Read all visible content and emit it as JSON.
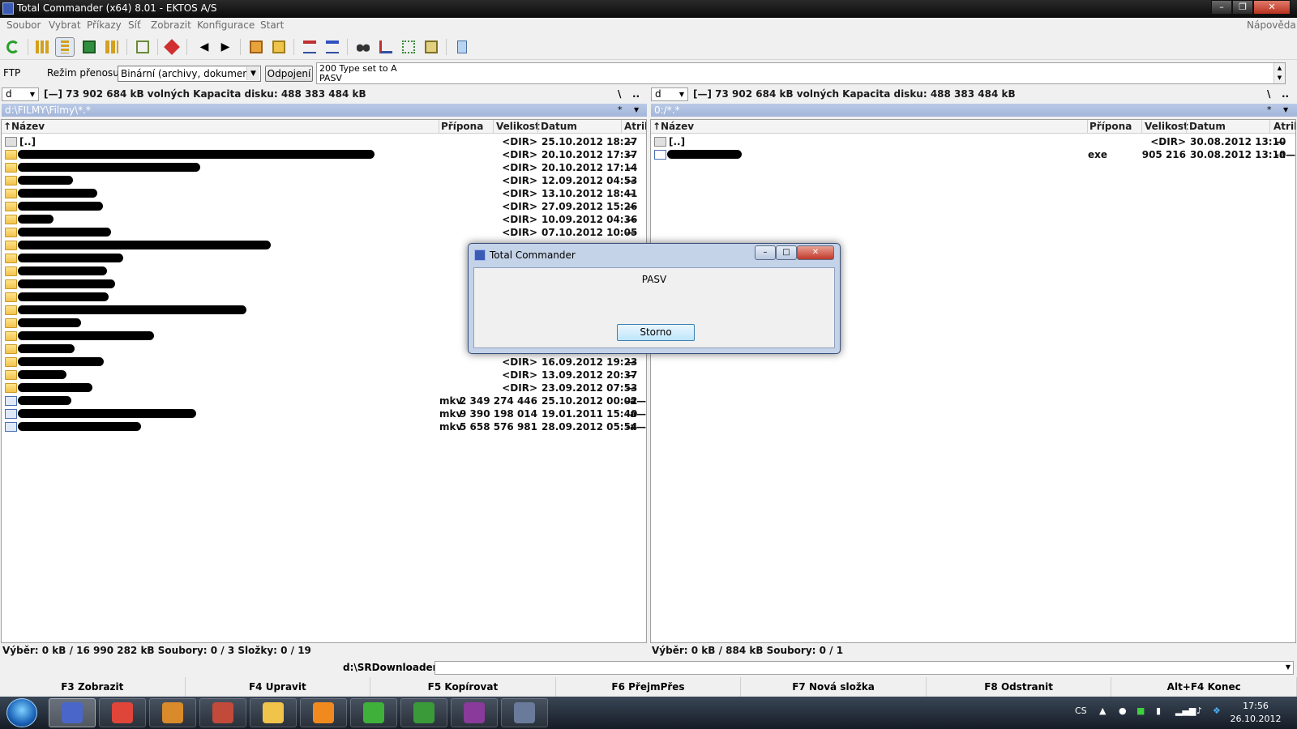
{
  "window": {
    "title": "Total Commander (x64) 8.01 - EKTOS A/S"
  },
  "menu": {
    "items": [
      "Soubor",
      "Vybrat",
      "Příkazy",
      "Síť",
      "Zobrazit",
      "Konfigurace",
      "Start"
    ],
    "help": "Nápověda"
  },
  "ftp": {
    "label": "FTP",
    "mode_label": "Režim přenosu",
    "mode_value": "Binární (archivy, dokument",
    "disconnect": "Odpojení",
    "log": [
      "200 Type set to A",
      "PASV"
    ]
  },
  "left": {
    "drive": "d",
    "drive_info": "[—]  73 902 684 kB volných  Kapacita disku: 488 383 484 kB",
    "nav_root": "\\",
    "nav_up": "..",
    "path": "d:\\FILMY\\Filmy\\*.*",
    "filter": "*",
    "columns": {
      "name": "Název",
      "ext": "Přípona",
      "size": "Velikost",
      "date": "Datum",
      "attr": "Atribu"
    },
    "rows": [
      {
        "name": "[..]",
        "ext": "",
        "size": "<DIR>",
        "date": "25.10.2012 18:27",
        "attr": "—",
        "icon": "updir",
        "redact": 0
      },
      {
        "name": "",
        "ext": "",
        "size": "<DIR>",
        "date": "20.10.2012 17:37",
        "attr": "—",
        "icon": "folder",
        "redact": 440
      },
      {
        "name": "",
        "ext": "",
        "size": "<DIR>",
        "date": "20.10.2012 17:14",
        "attr": "—",
        "icon": "folder",
        "redact": 225
      },
      {
        "name": "",
        "ext": "",
        "size": "<DIR>",
        "date": "12.09.2012 04:53",
        "attr": "—",
        "icon": "folder",
        "redact": 68
      },
      {
        "name": "",
        "ext": "",
        "size": "<DIR>",
        "date": "13.10.2012 18:41",
        "attr": "—",
        "icon": "folder",
        "redact": 98
      },
      {
        "name": "",
        "ext": "",
        "size": "<DIR>",
        "date": "27.09.2012 15:26",
        "attr": "—",
        "icon": "folder",
        "redact": 105
      },
      {
        "name": "",
        "ext": "",
        "size": "<DIR>",
        "date": "10.09.2012 04:36",
        "attr": "—",
        "icon": "folder",
        "redact": 44
      },
      {
        "name": "",
        "ext": "",
        "size": "<DIR>",
        "date": "07.10.2012 10:05",
        "attr": "—",
        "icon": "folder",
        "redact": 115
      },
      {
        "name": "",
        "ext": "",
        "size": "",
        "date": "",
        "attr": "",
        "icon": "folder",
        "redact": 312
      },
      {
        "name": "",
        "ext": "",
        "size": "",
        "date": "",
        "attr": "",
        "icon": "folder",
        "redact": 130
      },
      {
        "name": "",
        "ext": "",
        "size": "",
        "date": "",
        "attr": "",
        "icon": "folder",
        "redact": 110
      },
      {
        "name": "",
        "ext": "",
        "size": "",
        "date": "",
        "attr": "",
        "icon": "folder",
        "redact": 120
      },
      {
        "name": "",
        "ext": "",
        "size": "",
        "date": "",
        "attr": "",
        "icon": "folder",
        "redact": 112
      },
      {
        "name": "",
        "ext": "",
        "size": "",
        "date": "",
        "attr": "",
        "icon": "folder",
        "redact": 282
      },
      {
        "name": "",
        "ext": "",
        "size": "",
        "date": "",
        "attr": "",
        "icon": "folder",
        "redact": 78
      },
      {
        "name": "",
        "ext": "",
        "size": "",
        "date": "",
        "attr": "",
        "icon": "folder",
        "redact": 168
      },
      {
        "name": "",
        "ext": "",
        "size": "",
        "date": "",
        "attr": "",
        "icon": "folder",
        "redact": 70
      },
      {
        "name": "",
        "ext": "",
        "size": "<DIR>",
        "date": "16.09.2012 19:23",
        "attr": "—",
        "icon": "folder",
        "redact": 106
      },
      {
        "name": "",
        "ext": "",
        "size": "<DIR>",
        "date": "13.09.2012 20:37",
        "attr": "—",
        "icon": "folder",
        "redact": 60
      },
      {
        "name": "",
        "ext": "",
        "size": "<DIR>",
        "date": "23.09.2012 07:53",
        "attr": "—",
        "icon": "folder",
        "redact": 92
      },
      {
        "name": "",
        "ext": "mkv",
        "size": "2 349 274 446",
        "date": "25.10.2012 00:02",
        "attr": "-a—",
        "icon": "mkv",
        "redact": 66
      },
      {
        "name": "",
        "ext": "mkv",
        "size": "9 390 198 014",
        "date": "19.01.2011 15:40",
        "attr": "-a—",
        "icon": "mkv",
        "redact": 220
      },
      {
        "name": "",
        "ext": "mkv",
        "size": "5 658 576 981",
        "date": "28.09.2012 05:54",
        "attr": "-a—",
        "icon": "mkv",
        "redact": 152
      }
    ],
    "status": "Výběr: 0 kB / 16 990 282 kB  Soubory: 0 / 3  Složky: 0 / 19"
  },
  "right": {
    "drive": "d",
    "drive_info": "[—]  73 902 684 kB volných  Kapacita disku: 488 383 484 kB",
    "nav_root": "\\",
    "nav_up": "..",
    "path": "0:/*.*",
    "filter": "*",
    "columns": {
      "name": "Název",
      "ext": "Přípona",
      "size": "Velikost",
      "date": "Datum",
      "attr": "Atribu"
    },
    "rows": [
      {
        "name": "[..]",
        "ext": "",
        "size": "<DIR>",
        "date": "30.08.2012 13:10",
        "attr": "—",
        "icon": "updir",
        "redact": 0
      },
      {
        "name": "",
        "ext": "exe",
        "size": "905 216",
        "date": "30.08.2012 13:10",
        "attr": "-a—",
        "icon": "exe",
        "redact": 92
      }
    ],
    "status": "Výběr: 0 kB / 884 kB  Soubory: 0 / 1"
  },
  "cmdline": {
    "prompt": "d:\\SRDownloader>"
  },
  "fkeys": [
    "F3 Zobrazit",
    "F4 Upravit",
    "F5 Kopírovat",
    "F6 PřejmPřes",
    "F7 Nová složka",
    "F8 Odstranit",
    "Alt+F4 Konec"
  ],
  "dialog": {
    "title": "Total Commander",
    "message": "PASV",
    "button": "Storno"
  },
  "tray": {
    "lang": "CS",
    "time": "17:56",
    "date": "26.10.2012"
  },
  "taskbar": {
    "apps": [
      {
        "name": "total-commander-taskbar",
        "color": "#4a66c9"
      },
      {
        "name": "chrome-taskbar",
        "color": "#e0453a"
      },
      {
        "name": "monkey-app-taskbar",
        "color": "#d98a2b"
      },
      {
        "name": "clown-app-taskbar",
        "color": "#c24a3a"
      },
      {
        "name": "mail-app-taskbar",
        "color": "#f0c34a"
      },
      {
        "name": "media-player-taskbar",
        "color": "#f08a1e"
      },
      {
        "name": "window-app-taskbar",
        "color": "#3fb03a"
      },
      {
        "name": "utorrent-taskbar",
        "color": "#3a9a3a"
      },
      {
        "name": "winrar-taskbar",
        "color": "#8a3a9a"
      },
      {
        "name": "download-app-taskbar",
        "color": "#6a7a9a"
      }
    ]
  }
}
